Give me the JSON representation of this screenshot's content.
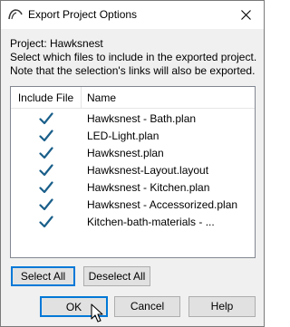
{
  "window": {
    "title": "Export Project Options",
    "close_symbol": "✕",
    "icon": "house-roof-icon"
  },
  "description": {
    "project_line": "Project: Hawksnest",
    "line1": "Select which files to include in the exported project.",
    "line2": "Note that the selection's links will also be exported."
  },
  "file_list": {
    "columns": [
      "Include File",
      "Name"
    ],
    "rows": [
      {
        "included": true,
        "name": "Hawksnest - Bath.plan"
      },
      {
        "included": true,
        "name": "LED-Light.plan"
      },
      {
        "included": true,
        "name": "Hawksnest.plan"
      },
      {
        "included": true,
        "name": "Hawksnest-Layout.layout"
      },
      {
        "included": true,
        "name": "Hawksnest - Kitchen.plan"
      },
      {
        "included": true,
        "name": "Hawksnest - Accessorized.plan"
      },
      {
        "included": true,
        "name": "Kitchen-bath-materials - ..."
      }
    ]
  },
  "buttons": {
    "select_all": "Select All",
    "deselect_all": "Deselect All",
    "ok": "OK",
    "cancel": "Cancel",
    "help": "Help"
  },
  "colors": {
    "accent": "#0078d7",
    "check": "#1a5f8a"
  }
}
